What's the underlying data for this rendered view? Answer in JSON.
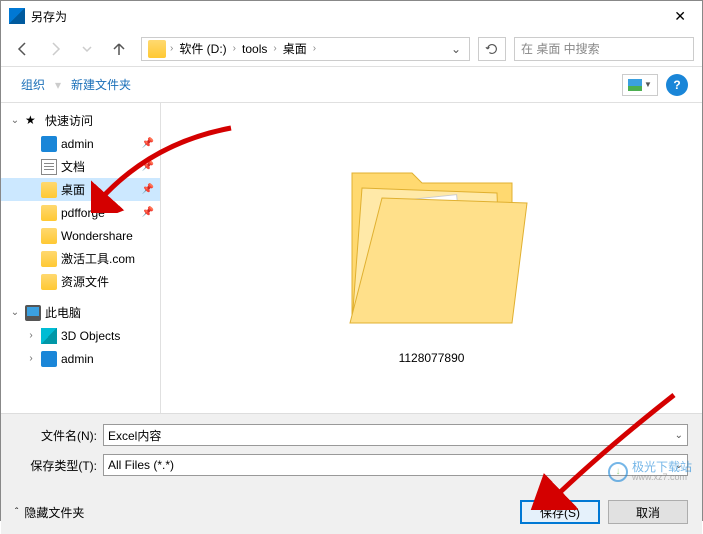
{
  "title": "另存为",
  "breadcrumb": {
    "drive": "软件 (D:)",
    "p1": "tools",
    "p2": "桌面"
  },
  "search": {
    "placeholder": "在 桌面 中搜索"
  },
  "toolbar": {
    "organize": "组织",
    "new_folder": "新建文件夹"
  },
  "tree": {
    "quick": "快速访问",
    "items": [
      "admin",
      "文档",
      "桌面",
      "pdfforge",
      "Wondershare",
      "激活工具.com",
      "资源文件"
    ],
    "this_pc": "此电脑",
    "pc_items": [
      "3D Objects",
      "admin"
    ]
  },
  "content": {
    "item_name": "1128077890"
  },
  "filename": {
    "label": "文件名(N):",
    "value": "Excel内容"
  },
  "filetype": {
    "label": "保存类型(T):",
    "value": "All Files (*.*)"
  },
  "footer": {
    "hide": "隐藏文件夹",
    "save": "保存(S)",
    "cancel": "取消"
  },
  "watermark": {
    "brand": "极光下载站",
    "url": "www.xz7.com"
  }
}
